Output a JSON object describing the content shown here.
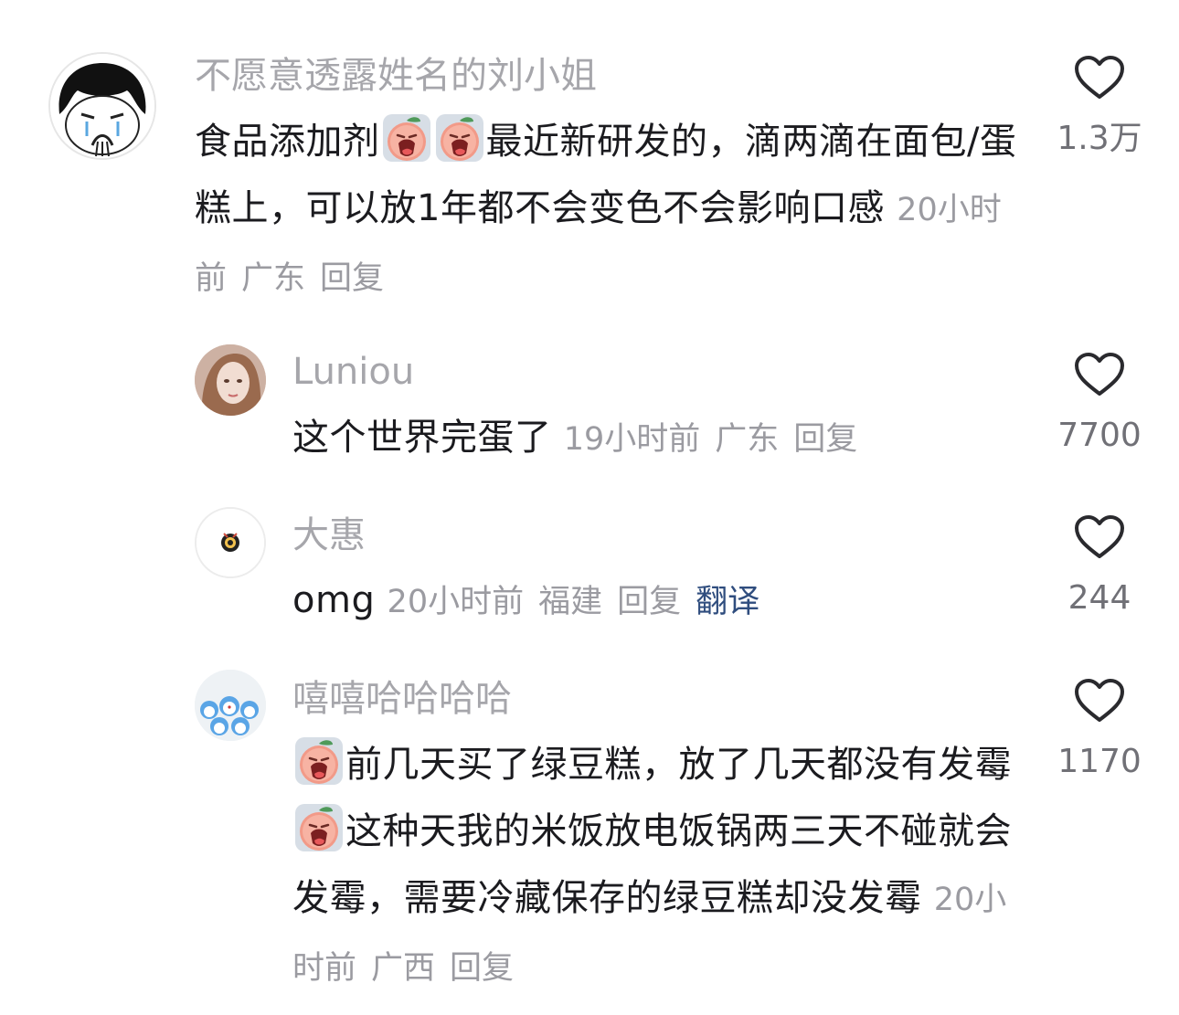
{
  "comments": [
    {
      "username": "不愿意透露姓名的刘小姐",
      "text_parts": [
        "食品添加剂",
        "最近新研发的，滴两滴在面包/蛋糕上，可以放1年都不会变色不会影响口感"
      ],
      "time": "20小时前",
      "location": "广东",
      "reply": "回复",
      "likes": "1.3万",
      "emoji": "crying-peach-emoji"
    },
    {
      "username": "Luniou",
      "text": "这个世界完蛋了",
      "time": "19小时前",
      "location": "广东",
      "reply": "回复",
      "likes": "7700"
    },
    {
      "username": "大惠",
      "text": "omg",
      "time": "20小时前",
      "location": "福建",
      "reply": "回复",
      "translate": "翻译",
      "likes": "244"
    },
    {
      "username": "嘻嘻哈哈哈哈",
      "text_parts": [
        "前几天买了绿豆糕，放了几天都没有发霉",
        "这种天我的米饭放电饭锅两三天不碰就会发霉，需要冷藏保存的绿豆糕却没发霉"
      ],
      "time": "20小时前",
      "location": "广西",
      "reply": "回复",
      "likes": "1170",
      "emoji": "crying-peach-emoji"
    }
  ],
  "icons": {
    "like": "heart-outline-icon"
  },
  "colors": {
    "username": "#a6a6ab",
    "text": "#1b1b1f",
    "meta": "#9b9ba1",
    "translate": "#2f4d7e",
    "heart": "#2a2a2e"
  }
}
